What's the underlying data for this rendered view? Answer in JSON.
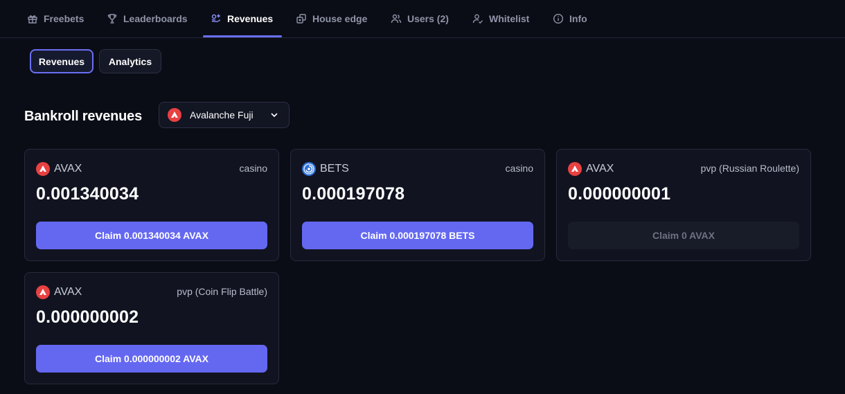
{
  "nav": {
    "items": [
      {
        "label": "Freebets",
        "icon": "gift-icon"
      },
      {
        "label": "Leaderboards",
        "icon": "trophy-icon"
      },
      {
        "label": "Revenues",
        "icon": "revenue-icon",
        "active": true
      },
      {
        "label": "House edge",
        "icon": "house-edge-icon"
      },
      {
        "label": "Users (2)",
        "icon": "users-icon"
      },
      {
        "label": "Whitelist",
        "icon": "user-check-icon"
      },
      {
        "label": "Info",
        "icon": "info-icon"
      }
    ]
  },
  "subtabs": [
    {
      "label": "Revenues",
      "active": true
    },
    {
      "label": "Analytics",
      "active": false
    }
  ],
  "section": {
    "title": "Bankroll revenues",
    "network": {
      "label": "Avalanche Fuji",
      "icon": "avalanche-icon"
    }
  },
  "cards": [
    {
      "token": "AVAX",
      "source": "casino",
      "amount": "0.001340034",
      "claim_label": "Claim 0.001340034 AVAX",
      "claim_enabled": true,
      "icon": "avalanche-icon"
    },
    {
      "token": "BETS",
      "source": "casino",
      "amount": "0.000197078",
      "claim_label": "Claim 0.000197078 BETS",
      "claim_enabled": true,
      "icon": "bets-icon"
    },
    {
      "token": "AVAX",
      "source": "pvp (Russian Roulette)",
      "amount": "0.000000001",
      "claim_label": "Claim 0 AVAX",
      "claim_enabled": false,
      "icon": "avalanche-icon"
    },
    {
      "token": "AVAX",
      "source": "pvp (Coin Flip Battle)",
      "amount": "0.000000002",
      "claim_label": "Claim 0.000000002 AVAX",
      "claim_enabled": true,
      "icon": "avalanche-icon"
    }
  ],
  "colors": {
    "background": "#0b0d16",
    "accent": "#6a6ff5",
    "claim_button": "#6468f1",
    "avalanche_red": "#e84142"
  }
}
